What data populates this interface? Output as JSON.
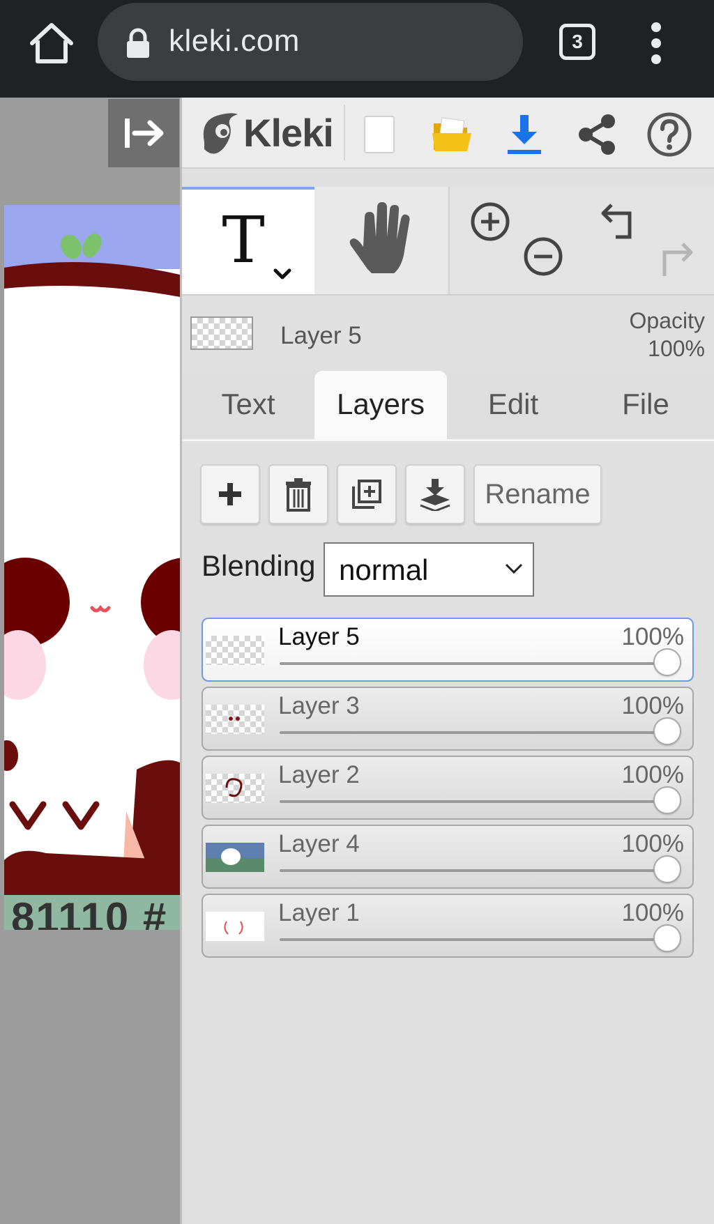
{
  "browser": {
    "url": "kleki.com",
    "tab_count": "3"
  },
  "canvas": {
    "visible_text": "81110 #"
  },
  "app": {
    "logo_text": "Kleki"
  },
  "current_layer": {
    "name": "Layer 5",
    "opacity_label": "Opacity",
    "opacity_value": "100%"
  },
  "tabs": [
    {
      "label": "Text",
      "active": false
    },
    {
      "label": "Layers",
      "active": true
    },
    {
      "label": "Edit",
      "active": false
    },
    {
      "label": "File",
      "active": false
    }
  ],
  "actions": {
    "rename_label": "Rename"
  },
  "blending": {
    "label": "Blending",
    "value": "normal"
  },
  "layers": [
    {
      "name": "Layer 5",
      "opacity": "100%",
      "opacity_fraction": 1.0,
      "selected": true
    },
    {
      "name": "Layer 3",
      "opacity": "100%",
      "opacity_fraction": 1.0,
      "selected": false
    },
    {
      "name": "Layer 2",
      "opacity": "100%",
      "opacity_fraction": 1.0,
      "selected": false
    },
    {
      "name": "Layer 4",
      "opacity": "100%",
      "opacity_fraction": 1.0,
      "selected": false
    },
    {
      "name": "Layer 1",
      "opacity": "100%",
      "opacity_fraction": 1.0,
      "selected": false
    }
  ],
  "colors": {
    "accent": "#1a73e8",
    "selection_border": "#6d98e8",
    "panel_bg": "#e0e0e0",
    "chrome_bg": "#202124"
  },
  "icons": [
    "home-icon",
    "lock-icon",
    "tabs-icon",
    "more-vert-icon",
    "collapse-panel-icon",
    "kleki-logo-icon",
    "new-image-icon",
    "open-folder-icon",
    "download-icon",
    "share-icon",
    "help-icon",
    "text-tool-icon",
    "hand-tool-icon",
    "zoom-in-icon",
    "zoom-out-icon",
    "undo-icon",
    "redo-icon",
    "add-layer-icon",
    "delete-layer-icon",
    "duplicate-layer-icon",
    "merge-down-icon"
  ]
}
